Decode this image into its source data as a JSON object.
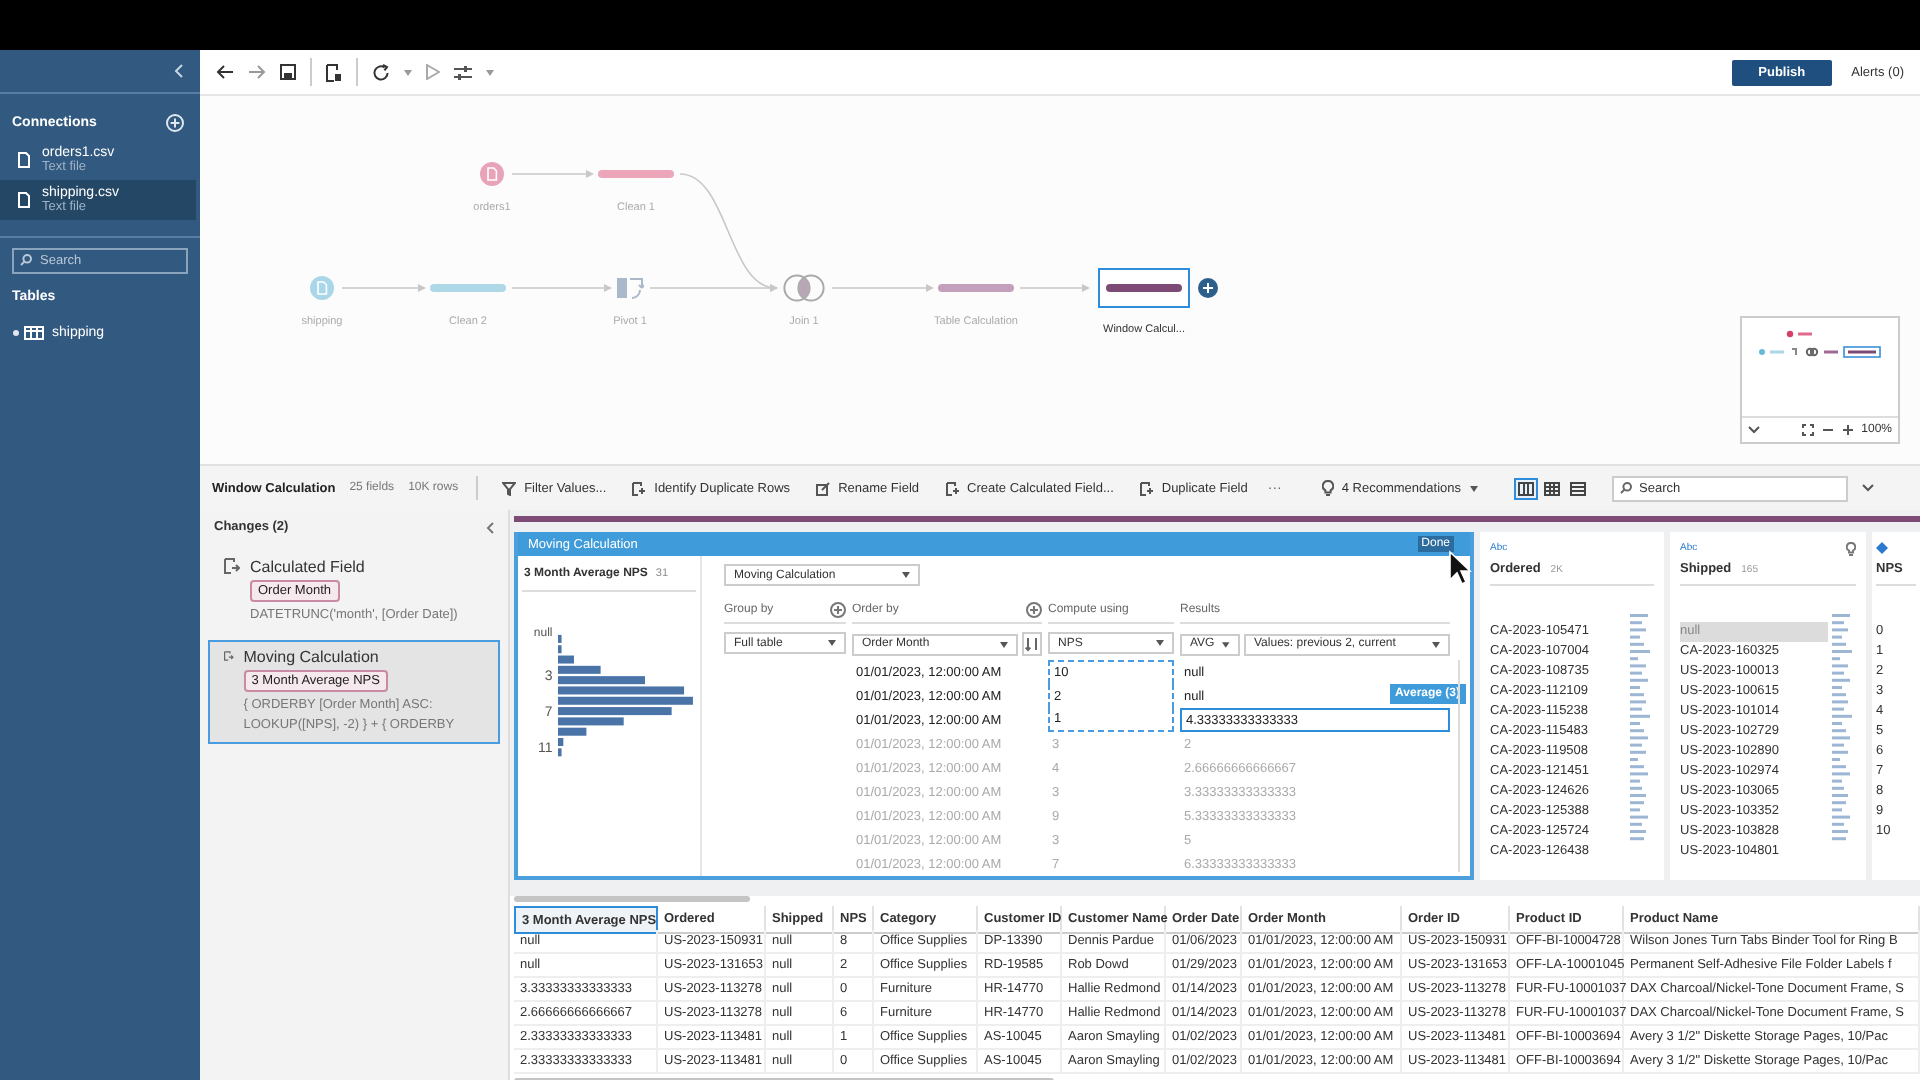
{
  "sidebar": {
    "connections_title": "Connections",
    "connections": [
      {
        "name": "orders1.csv",
        "type": "Text file",
        "selected": false
      },
      {
        "name": "shipping.csv",
        "type": "Text file",
        "selected": true
      }
    ],
    "search": {
      "placeholder": "Search"
    },
    "tables_title": "Tables",
    "tables": [
      {
        "name": "shipping"
      }
    ]
  },
  "toolbar": {
    "publish": "Publish",
    "alerts": "Alerts (0)"
  },
  "flow": {
    "nodes": [
      {
        "label": "orders1",
        "kind": "input",
        "color": "#e8a3b8",
        "selected": false
      },
      {
        "label": "Clean 1",
        "kind": "clean",
        "color": "#eba6ba",
        "selected": false
      },
      {
        "label": "shipping",
        "kind": "input",
        "color": "#a9d6e8",
        "selected": false
      },
      {
        "label": "Clean 2",
        "kind": "clean",
        "color": "#aed8e8",
        "selected": false
      },
      {
        "label": "Pivot 1",
        "kind": "pivot",
        "color": "#a9b9c9",
        "selected": false
      },
      {
        "label": "Join 1",
        "kind": "join",
        "color": "#b9a6b6",
        "selected": false
      },
      {
        "label": "Table Calculation",
        "kind": "clean",
        "color": "#c4a0bd",
        "selected": false
      },
      {
        "label": "Window Calcul...",
        "kind": "calc",
        "color": "#7c4a75",
        "selected": true
      }
    ],
    "minimap_zoom": "100%"
  },
  "step_bar": {
    "title": "Window Calculation",
    "fields": "25 fields",
    "rows": "10K rows",
    "actions": [
      {
        "label": "Filter Values...",
        "kind": "filter"
      },
      {
        "label": "Identify Duplicate Rows",
        "kind": "dedupe"
      },
      {
        "label": "Rename Field",
        "kind": "rename"
      },
      {
        "label": "Create Calculated Field...",
        "kind": "calc"
      },
      {
        "label": "Duplicate Field",
        "kind": "duplicate"
      }
    ],
    "more": "···",
    "recommendations": "4 Recommendations",
    "view_modes": [
      {
        "selected": true
      },
      {
        "selected": false
      },
      {
        "selected": false
      }
    ],
    "search": {
      "placeholder": "Search"
    }
  },
  "changes": {
    "title": "Changes (2)",
    "items": [
      {
        "title": "Calculated Field",
        "field": "Order Month",
        "formula": "DATETRUNC('month', [Order Date])",
        "selected": false
      },
      {
        "title": "Moving Calculation",
        "field": "3 Month Average NPS",
        "formula": "{ ORDERBY [Order Month] ASC: LOOKUP([NPS], -2) } + { ORDERBY",
        "selected": true
      }
    ]
  },
  "moving_calc": {
    "header": "Moving Calculation",
    "done": "Done",
    "profile": {
      "title": "3 Month Average NPS",
      "count": "31",
      "axis_labels": [
        "null",
        "3",
        "7",
        "11"
      ]
    },
    "calc_type": "Moving Calculation",
    "group_by": {
      "label": "Group by",
      "value": "Full table"
    },
    "order_by": {
      "label": "Order by",
      "value": "Order Month"
    },
    "compute_using": {
      "label": "Compute using",
      "value": "NPS"
    },
    "results": {
      "label": "Results",
      "aggregation": "AVG",
      "window": "Values: previous 2, current",
      "badge": "Average (3)"
    },
    "rows": [
      {
        "order_month": "01/01/2023, 12:00:00 AM",
        "nps": "10",
        "result": "null",
        "in_window": true,
        "selected": false
      },
      {
        "order_month": "01/01/2023, 12:00:00 AM",
        "nps": "2",
        "result": "null",
        "in_window": true,
        "selected": false
      },
      {
        "order_month": "01/01/2023, 12:00:00 AM",
        "nps": "1",
        "result": "4.33333333333333",
        "in_window": true,
        "selected": true
      },
      {
        "order_month": "01/01/2023, 12:00:00 AM",
        "nps": "3",
        "result": "2",
        "in_window": false,
        "selected": false
      },
      {
        "order_month": "01/01/2023, 12:00:00 AM",
        "nps": "4",
        "result": "2.66666666666667",
        "in_window": false,
        "selected": false
      },
      {
        "order_month": "01/01/2023, 12:00:00 AM",
        "nps": "3",
        "result": "3.33333333333333",
        "in_window": false,
        "selected": false
      },
      {
        "order_month": "01/01/2023, 12:00:00 AM",
        "nps": "9",
        "result": "5.33333333333333",
        "in_window": false,
        "selected": false
      },
      {
        "order_month": "01/01/2023, 12:00:00 AM",
        "nps": "3",
        "result": "5",
        "in_window": false,
        "selected": false
      },
      {
        "order_month": "01/01/2023, 12:00:00 AM",
        "nps": "7",
        "result": "6.33333333333333",
        "in_window": false,
        "selected": false
      }
    ]
  },
  "columns": [
    {
      "kind": "text",
      "type": "Abc",
      "name": "Ordered",
      "count": "2K",
      "has_recommendation": false,
      "values": [
        {
          "text": "CA-2023-105471",
          "selected": false
        },
        {
          "text": "CA-2023-107004",
          "selected": false
        },
        {
          "text": "CA-2023-108735",
          "selected": false
        },
        {
          "text": "CA-2023-112109",
          "selected": false
        },
        {
          "text": "CA-2023-115238",
          "selected": false
        },
        {
          "text": "CA-2023-115483",
          "selected": false
        },
        {
          "text": "CA-2023-119508",
          "selected": false
        },
        {
          "text": "CA-2023-121451",
          "selected": false
        },
        {
          "text": "CA-2023-124626",
          "selected": false
        },
        {
          "text": "CA-2023-125388",
          "selected": false
        },
        {
          "text": "CA-2023-125724",
          "selected": false
        },
        {
          "text": "CA-2023-126438",
          "selected": false
        }
      ]
    },
    {
      "kind": "text",
      "type": "Abc",
      "name": "Shipped",
      "count": "165",
      "has_recommendation": true,
      "values": [
        {
          "text": "null",
          "selected": true
        },
        {
          "text": "CA-2023-160325",
          "selected": false
        },
        {
          "text": "US-2023-100013",
          "selected": false
        },
        {
          "text": "US-2023-100615",
          "selected": false
        },
        {
          "text": "US-2023-101014",
          "selected": false
        },
        {
          "text": "US-2023-102729",
          "selected": false
        },
        {
          "text": "US-2023-102890",
          "selected": false
        },
        {
          "text": "US-2023-102974",
          "selected": false
        },
        {
          "text": "US-2023-103065",
          "selected": false
        },
        {
          "text": "US-2023-103352",
          "selected": false
        },
        {
          "text": "US-2023-103828",
          "selected": false
        },
        {
          "text": "US-2023-104801",
          "selected": false
        }
      ]
    },
    {
      "kind": "number",
      "name": "NPS",
      "has_recommendation": false,
      "values": [
        {
          "text": "0",
          "selected": false
        },
        {
          "text": "1",
          "selected": false
        },
        {
          "text": "2",
          "selected": false
        },
        {
          "text": "3",
          "selected": false
        },
        {
          "text": "4",
          "selected": false
        },
        {
          "text": "5",
          "selected": false
        },
        {
          "text": "6",
          "selected": false
        },
        {
          "text": "7",
          "selected": false
        },
        {
          "text": "8",
          "selected": false
        },
        {
          "text": "9",
          "selected": false
        },
        {
          "text": "10",
          "selected": false
        }
      ]
    }
  ],
  "grid": {
    "columns": [
      {
        "name": "3 Month Average NPS",
        "selected": true
      },
      {
        "name": "Ordered",
        "selected": false
      },
      {
        "name": "Shipped",
        "selected": false
      },
      {
        "name": "NPS",
        "selected": false
      },
      {
        "name": "Category",
        "selected": false
      },
      {
        "name": "Customer ID",
        "selected": false
      },
      {
        "name": "Customer Name",
        "selected": false
      },
      {
        "name": "Order Date",
        "selected": false
      },
      {
        "name": "Order Month",
        "selected": false
      },
      {
        "name": "Order ID",
        "selected": false
      },
      {
        "name": "Product ID",
        "selected": false
      },
      {
        "name": "Product Name",
        "selected": false
      }
    ],
    "rows": [
      [
        "null",
        "US-2023-150931",
        "null",
        "8",
        "Office Supplies",
        "DP-13390",
        "Dennis Pardue",
        "01/06/2023",
        "01/01/2023, 12:00:00 AM",
        "US-2023-150931",
        "OFF-BI-10004728",
        "Wilson Jones Turn Tabs Binder Tool for Ring B"
      ],
      [
        "null",
        "US-2023-131653",
        "null",
        "2",
        "Office Supplies",
        "RD-19585",
        "Rob Dowd",
        "01/29/2023",
        "01/01/2023, 12:00:00 AM",
        "US-2023-131653",
        "OFF-LA-10001045",
        "Permanent Self-Adhesive File Folder Labels f"
      ],
      [
        "3.33333333333333",
        "US-2023-113278",
        "null",
        "0",
        "Furniture",
        "HR-14770",
        "Hallie Redmond",
        "01/14/2023",
        "01/01/2023, 12:00:00 AM",
        "US-2023-113278",
        "FUR-FU-10001037",
        "DAX Charcoal/Nickel-Tone Document Frame, S"
      ],
      [
        "2.66666666666667",
        "US-2023-113278",
        "null",
        "6",
        "Furniture",
        "HR-14770",
        "Hallie Redmond",
        "01/14/2023",
        "01/01/2023, 12:00:00 AM",
        "US-2023-113278",
        "FUR-FU-10001037",
        "DAX Charcoal/Nickel-Tone Document Frame, S"
      ],
      [
        "2.33333333333333",
        "US-2023-113481",
        "null",
        "1",
        "Office Supplies",
        "AS-10045",
        "Aaron Smayling",
        "01/02/2023",
        "01/01/2023, 12:00:00 AM",
        "US-2023-113481",
        "OFF-BI-10003694",
        "Avery 3 1/2\" Diskette Storage Pages, 10/Pac"
      ],
      [
        "2.33333333333333",
        "US-2023-113481",
        "null",
        "0",
        "Office Supplies",
        "AS-10045",
        "Aaron Smayling",
        "01/02/2023",
        "01/01/2023, 12:00:00 AM",
        "US-2023-113481",
        "OFF-BI-10003694",
        "Avery 3 1/2\" Diskette Storage Pages, 10/Pac"
      ]
    ]
  }
}
